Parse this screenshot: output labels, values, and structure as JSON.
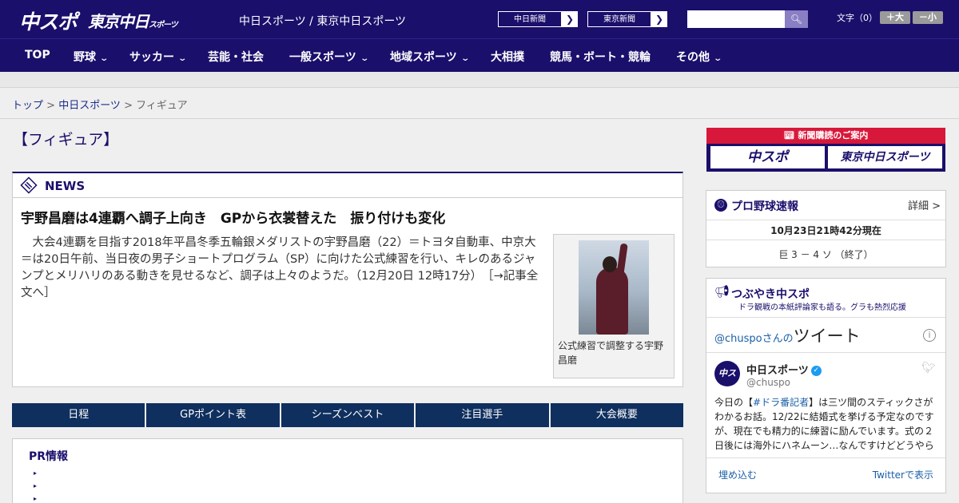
{
  "header": {
    "logo_main": "中スポ",
    "logo_tokyo": "東京中日",
    "logo_tokyo_small": "スポーツ",
    "site_name": "中日スポーツ / 東京中日スポーツ",
    "ext_links": [
      {
        "label": "中日新聞"
      },
      {
        "label": "東京新聞"
      }
    ],
    "search_placeholder": "",
    "fontsize_label": "文字（0）",
    "font_plus": "＋大",
    "font_minus": "－小"
  },
  "nav": [
    {
      "label": "TOP"
    },
    {
      "label": "野球"
    },
    {
      "label": "サッカー"
    },
    {
      "label": "芸能・社会"
    },
    {
      "label": "一般スポーツ"
    },
    {
      "label": "地域スポーツ"
    },
    {
      "label": "大相撲"
    },
    {
      "label": "競馬・ボート・競輪"
    },
    {
      "label": "その他"
    }
  ],
  "breadcrumb": {
    "items": [
      "トップ",
      "中日スポーツ"
    ],
    "current": "フィギュア",
    "sep": " > "
  },
  "page_title": "【フィギュア】",
  "news": {
    "section_label": "NEWS",
    "headline": "宇野昌磨は4連覇へ調子上向き　GPから衣裳替えた　振り付けも変化",
    "body": "　大会4連覇を目指す2018年平昌冬季五輪銀メダリストの宇野昌磨（22）＝トヨタ自動車、中京大＝は20日午前、当日夜の男子ショートプログラム（SP）に向けた公式練習を行い、キレのあるジャンプとメリハリのある動きを見せるなど、調子は上々のようだ。（12月20日 12時17分）　［→記事全文へ］",
    "photo_caption": "公式練習で調整する宇野昌磨"
  },
  "tabs": [
    {
      "label": "日程"
    },
    {
      "label": "GPポイント表"
    },
    {
      "label": "シーズンベスト"
    },
    {
      "label": "注目選手"
    },
    {
      "label": "大会概要"
    }
  ],
  "pr": {
    "title": "PR情報",
    "bullet": "▸"
  },
  "sidebar": {
    "subscribe_label": "新聞購読のご案内",
    "subscribe_logo_main": "中スポ",
    "subscribe_logo_tokyo": "東京中日スポーツ",
    "baseball": {
      "title": "プロ野球速報",
      "more": "詳細 >",
      "timestamp": "10月23日21時42分現在",
      "score": "巨 3 － 4 ソ （終了）"
    },
    "twitter": {
      "title": "つぶやき中スポ",
      "subtitle": "ドラ観戦の本紙評論家も語る。グラも熱烈応援",
      "handle_prefix": "@chuspo",
      "handle_suffix": "さんの",
      "tweets_label": "ツイート",
      "info": "i",
      "account_name": "中日スポーツ",
      "account_handle": "@chuspo",
      "avatar_text": "中スポ",
      "tweet_pre": "今日の【",
      "tweet_tag": "#ドラ番記者",
      "tweet_post": "】は三ツ間のスティックさがわかるお話。12/22に結婚式を挙げる予定なのですが、現在でも精力的に練習に励んでいます。式の２日後には海外にハネムーン…なんですけどどうやら",
      "embed": "埋め込む",
      "view_on": "Twitterで表示"
    }
  },
  "colors": {
    "brand_navy": "#1a0f6b",
    "tab_navy": "#0f2f5e",
    "accent_red": "#d8183a",
    "link_blue": "#1a5fa8"
  }
}
